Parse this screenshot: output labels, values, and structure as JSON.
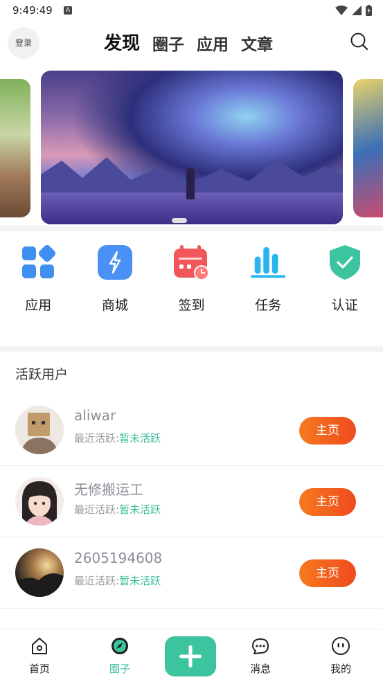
{
  "status_bar": {
    "time": "9:49:49",
    "badge": "A"
  },
  "header": {
    "login_label": "登录",
    "tabs": [
      {
        "label": "发现",
        "active": true
      },
      {
        "label": "圈子",
        "active": false
      },
      {
        "label": "应用",
        "active": false
      },
      {
        "label": "文章",
        "active": false
      }
    ]
  },
  "quick_actions": [
    {
      "label": "应用",
      "icon": "apps-grid-icon",
      "color": "#3f8ff0"
    },
    {
      "label": "商城",
      "icon": "lightning-icon",
      "color": "#4a90f5"
    },
    {
      "label": "签到",
      "icon": "calendar-icon",
      "color": "#f0565a"
    },
    {
      "label": "任务",
      "icon": "bar-chart-icon",
      "color": "#26b5ee"
    },
    {
      "label": "认证",
      "icon": "shield-check-icon",
      "color": "#3cc49e"
    }
  ],
  "active_users": {
    "title": "活跃用户",
    "users": [
      {
        "name": "aliwar",
        "active_prefix": "最近活跃:",
        "active_value": "暂未活跃",
        "button": "主页"
      },
      {
        "name": "无修搬运工",
        "active_prefix": "最近活跃:",
        "active_value": "暂未活跃",
        "button": "主页"
      },
      {
        "name": "2605194608",
        "active_prefix": "最近活跃:",
        "active_value": "暂未活跃",
        "button": "主页"
      }
    ]
  },
  "bottom_nav": {
    "items": [
      {
        "label": "首页",
        "icon": "home-icon",
        "active": false
      },
      {
        "label": "圈子",
        "icon": "compass-icon",
        "active": true
      },
      {
        "label": "消息",
        "icon": "chat-icon",
        "active": false
      },
      {
        "label": "我的",
        "icon": "profile-icon",
        "active": false
      }
    ],
    "add_icon": "plus-icon"
  },
  "colors": {
    "accent": "#3bbf9a",
    "button_gradient_start": "#f57a1e",
    "button_gradient_end": "#f04a1e"
  }
}
